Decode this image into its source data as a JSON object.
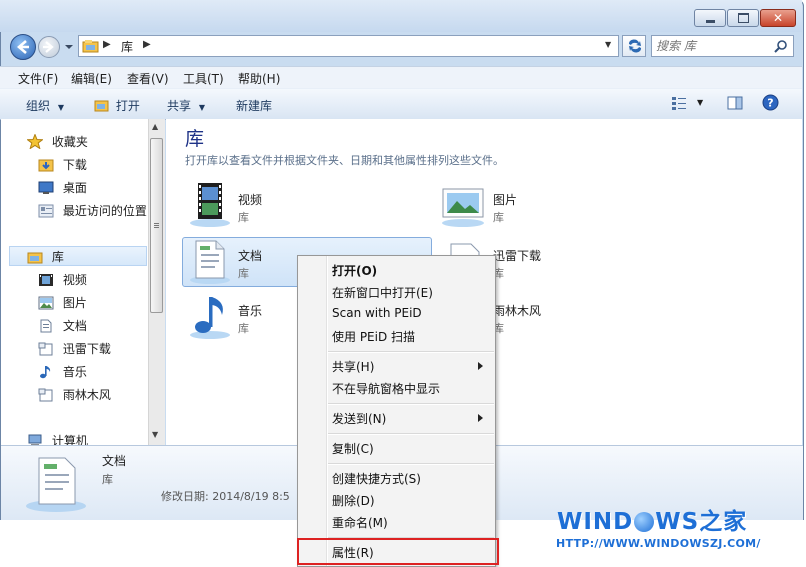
{
  "titlebar": {
    "controls": {
      "minimize": "minimize-icon",
      "maximize": "maximize-icon",
      "close": "close-icon"
    }
  },
  "address": {
    "segments": [
      "库"
    ],
    "search_placeholder": "搜索 库"
  },
  "menubar": {
    "items": [
      "文件(F)",
      "编辑(E)",
      "查看(V)",
      "工具(T)",
      "帮助(H)"
    ]
  },
  "toolbar": {
    "organize": "组织",
    "open": "打开",
    "share": "共享",
    "new_library": "新建库"
  },
  "nav": {
    "favorites": {
      "label": "收藏夹",
      "items": [
        "下载",
        "桌面",
        "最近访问的位置"
      ]
    },
    "libraries": {
      "label": "库",
      "items": [
        "视频",
        "图片",
        "文档",
        "迅雷下载",
        "音乐",
        "雨林木风"
      ]
    },
    "computer": {
      "label": "计算机"
    }
  },
  "content": {
    "title": "库",
    "description": "打开库以查看文件并根据文件夹、日期和其他属性排列这些文件。",
    "libraries": [
      {
        "name": "视频",
        "type": "库",
        "icon": "video-library-icon"
      },
      {
        "name": "图片",
        "type": "库",
        "icon": "pictures-library-icon"
      },
      {
        "name": "文档",
        "type": "库",
        "icon": "documents-library-icon",
        "selected": true
      },
      {
        "name": "迅雷下载",
        "type": "库",
        "icon": "xunlei-library-icon"
      },
      {
        "name": "音乐",
        "type": "库",
        "icon": "music-library-icon"
      },
      {
        "name": "雨林木风",
        "type": "库",
        "icon": "yulinmufeng-library-icon"
      }
    ]
  },
  "details": {
    "name": "文档",
    "type": "库",
    "modified": "修改日期: 2014/8/19 8:5"
  },
  "context_menu": {
    "items": [
      "打开(O)",
      "在新窗口中打开(E)",
      "Scan with PEiD",
      "使用 PEiD 扫描",
      "共享(H)",
      "不在导航窗格中显示",
      "发送到(N)",
      "复制(C)",
      "创建快捷方式(S)",
      "删除(D)",
      "重命名(M)",
      "属性(R)"
    ],
    "highlight": "属性(R)",
    "highlight_color": "#dd2222"
  },
  "watermark": {
    "logo_left": "WIND",
    "logo_right": "WS之家",
    "url": "HTTP://WWW.WINDOWSZJ.COM/"
  },
  "colors": {
    "accent": "#1e6fd6",
    "title": "#1e3287"
  }
}
